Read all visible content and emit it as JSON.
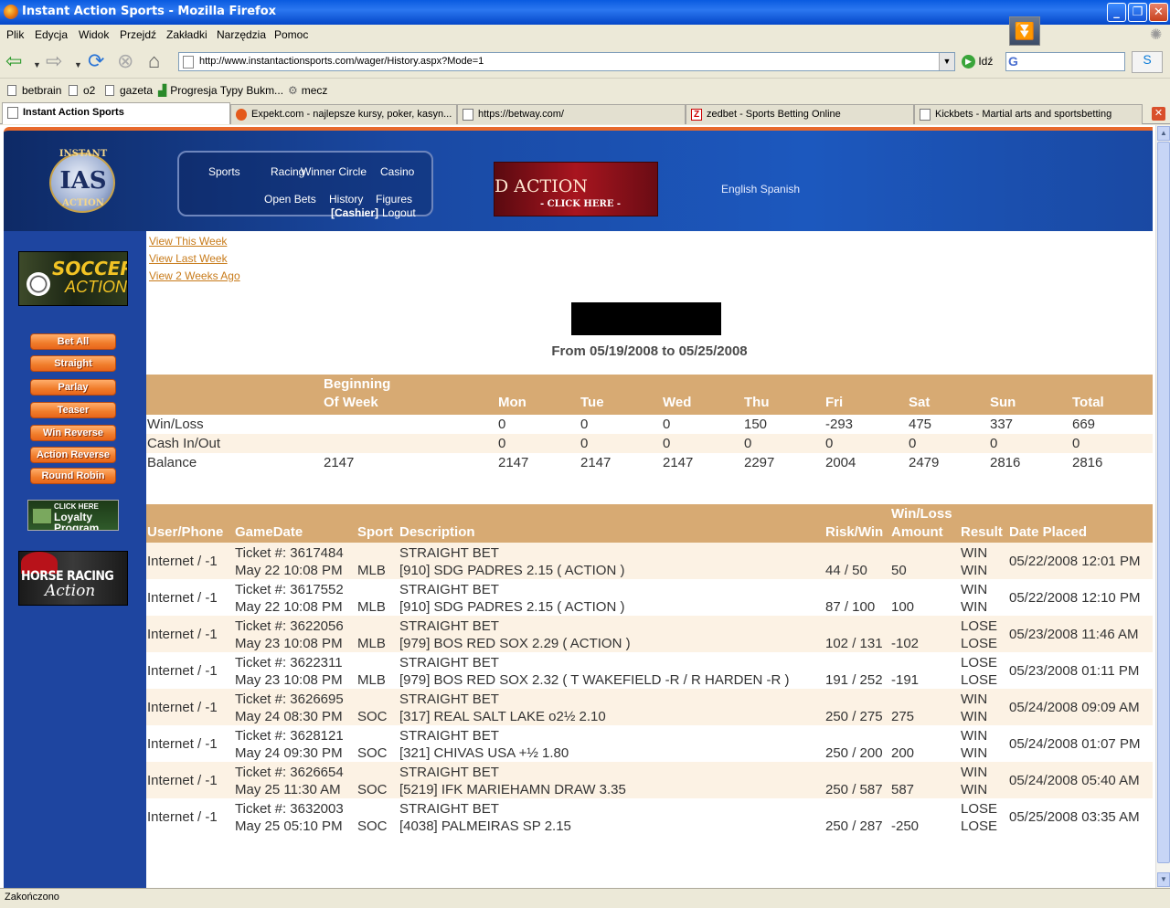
{
  "window": {
    "title": "Instant Action Sports - Mozilla Firefox"
  },
  "menu": [
    "Plik",
    "Edycja",
    "Widok",
    "Przejdź",
    "Zakładki",
    "Narzędzia",
    "Pomoc"
  ],
  "nav": {
    "url": "http://www.instantactionsports.com/wager/History.aspx?Mode=1",
    "go_label": "Idź"
  },
  "bookmarks": [
    "betbrain",
    "o2",
    "gazeta",
    "Progresja Typy Bukm...",
    "mecz"
  ],
  "tabs": [
    "Instant Action Sports",
    "Expekt.com - najlepsze kursy, poker, kasyn...",
    "https://betway.com/",
    "zedbet - Sports Betting Online",
    "Kickbets - Martial arts and sportsbetting"
  ],
  "site": {
    "logo": {
      "top": "INSTANT",
      "mid": "IAS",
      "bottom": "ACTION"
    },
    "topnav": {
      "sports": "Sports",
      "racing": "Racing",
      "winner_circle": "Winner Circle",
      "casino": "Casino",
      "open_bets": "Open Bets",
      "history": "History",
      "figures": "Figures",
      "cashier": "[Cashier]",
      "logout": "Logout"
    },
    "banner": {
      "big": "D ACTION",
      "small": "- CLICK HERE -"
    },
    "language": "English Spanish"
  },
  "sidebar": {
    "soccer": {
      "line1": "SOCCER",
      "line2": "ACTION"
    },
    "buttons": [
      "Bet All",
      "Straight",
      "Parlay",
      "Teaser",
      "Win Reverse",
      "Action Reverse",
      "Round Robin"
    ],
    "loyalty": {
      "small": "CLICK HERE",
      "line1": "Loyalty",
      "line2": "Program"
    },
    "horse": {
      "line1": "HORSE RACING",
      "line2": "Action"
    }
  },
  "main": {
    "week_links": [
      "View This Week",
      "View Last Week",
      "View 2 Weeks Ago"
    ],
    "date_range": "From 05/19/2008 to 05/25/2008",
    "weekly": {
      "headers": [
        "",
        "Beginning Of Week",
        "Mon",
        "Tue",
        "Wed",
        "Thu",
        "Fri",
        "Sat",
        "Sun",
        "Total"
      ],
      "rows": [
        [
          "Win/Loss",
          "",
          "0",
          "0",
          "0",
          "150",
          "-293",
          "475",
          "337",
          "669"
        ],
        [
          "Cash In/Out",
          "",
          "0",
          "0",
          "0",
          "0",
          "0",
          "0",
          "0",
          "0"
        ],
        [
          "Balance",
          "2147",
          "2147",
          "2147",
          "2147",
          "2297",
          "2004",
          "2479",
          "2816",
          "2816"
        ]
      ]
    },
    "history": {
      "headers": [
        "User/Phone",
        "GameDate",
        "Sport",
        "Description",
        "Risk/Win",
        "Win/Loss Amount",
        "Result",
        "Date Placed"
      ],
      "rows": [
        {
          "user": "Internet / -1",
          "ticket": "Ticket #: 3617484",
          "gamedate": "May 22 10:08 PM",
          "sport": "MLB",
          "type": "STRAIGHT BET",
          "desc": "[910] SDG PADRES 2.15 ( ACTION )",
          "riskwin": "44 / 50",
          "amount": "50",
          "result1": "WIN",
          "result2": "WIN",
          "placed": "05/22/2008 12:01 PM"
        },
        {
          "user": "Internet / -1",
          "ticket": "Ticket #: 3617552",
          "gamedate": "May 22 10:08 PM",
          "sport": "MLB",
          "type": "STRAIGHT BET",
          "desc": "[910] SDG PADRES 2.15 ( ACTION )",
          "riskwin": "87 / 100",
          "amount": "100",
          "result1": "WIN",
          "result2": "WIN",
          "placed": "05/22/2008 12:10 PM"
        },
        {
          "user": "Internet / -1",
          "ticket": "Ticket #: 3622056",
          "gamedate": "May 23 10:08 PM",
          "sport": "MLB",
          "type": "STRAIGHT BET",
          "desc": "[979] BOS RED SOX 2.29 ( ACTION )",
          "riskwin": "102 / 131",
          "amount": "-102",
          "result1": "LOSE",
          "result2": "LOSE",
          "placed": "05/23/2008 11:46 AM"
        },
        {
          "user": "Internet / -1",
          "ticket": "Ticket #: 3622311",
          "gamedate": "May 23 10:08 PM",
          "sport": "MLB",
          "type": "STRAIGHT BET",
          "desc": "[979] BOS RED SOX 2.32 ( T WAKEFIELD -R / R HARDEN -R )",
          "riskwin": "191 / 252",
          "amount": "-191",
          "result1": "LOSE",
          "result2": "LOSE",
          "placed": "05/23/2008 01:11 PM"
        },
        {
          "user": "Internet / -1",
          "ticket": "Ticket #: 3626695",
          "gamedate": "May 24 08:30 PM",
          "sport": "SOC",
          "type": "STRAIGHT BET",
          "desc": "[317] REAL SALT LAKE o2½ 2.10",
          "riskwin": "250 / 275",
          "amount": "275",
          "result1": "WIN",
          "result2": "WIN",
          "placed": "05/24/2008 09:09 AM"
        },
        {
          "user": "Internet / -1",
          "ticket": "Ticket #: 3628121",
          "gamedate": "May 24 09:30 PM",
          "sport": "SOC",
          "type": "STRAIGHT BET",
          "desc": "[321] CHIVAS USA +½ 1.80",
          "riskwin": "250 / 200",
          "amount": "200",
          "result1": "WIN",
          "result2": "WIN",
          "placed": "05/24/2008 01:07 PM"
        },
        {
          "user": "Internet / -1",
          "ticket": "Ticket #: 3626654",
          "gamedate": "May 25 11:30 AM",
          "sport": "SOC",
          "type": "STRAIGHT BET",
          "desc": "[5219] IFK MARIEHAMN DRAW 3.35",
          "riskwin": "250 / 587",
          "amount": "587",
          "result1": "WIN",
          "result2": "WIN",
          "placed": "05/24/2008 05:40 AM"
        },
        {
          "user": "Internet / -1",
          "ticket": "Ticket #: 3632003",
          "gamedate": "May 25 05:10 PM",
          "sport": "SOC",
          "type": "STRAIGHT BET",
          "desc": "[4038] PALMEIRAS SP 2.15",
          "riskwin": "250 / 287",
          "amount": "-250",
          "result1": "LOSE",
          "result2": "LOSE",
          "placed": "05/25/2008 03:35 AM"
        }
      ]
    }
  },
  "status": "Zakończono",
  "colors": {
    "header_band": "#d7aa73",
    "alt_row": "#fcf2e4",
    "sidebar": "#1e45a0",
    "link": "#c87b1a",
    "button": "#f07c2a"
  }
}
